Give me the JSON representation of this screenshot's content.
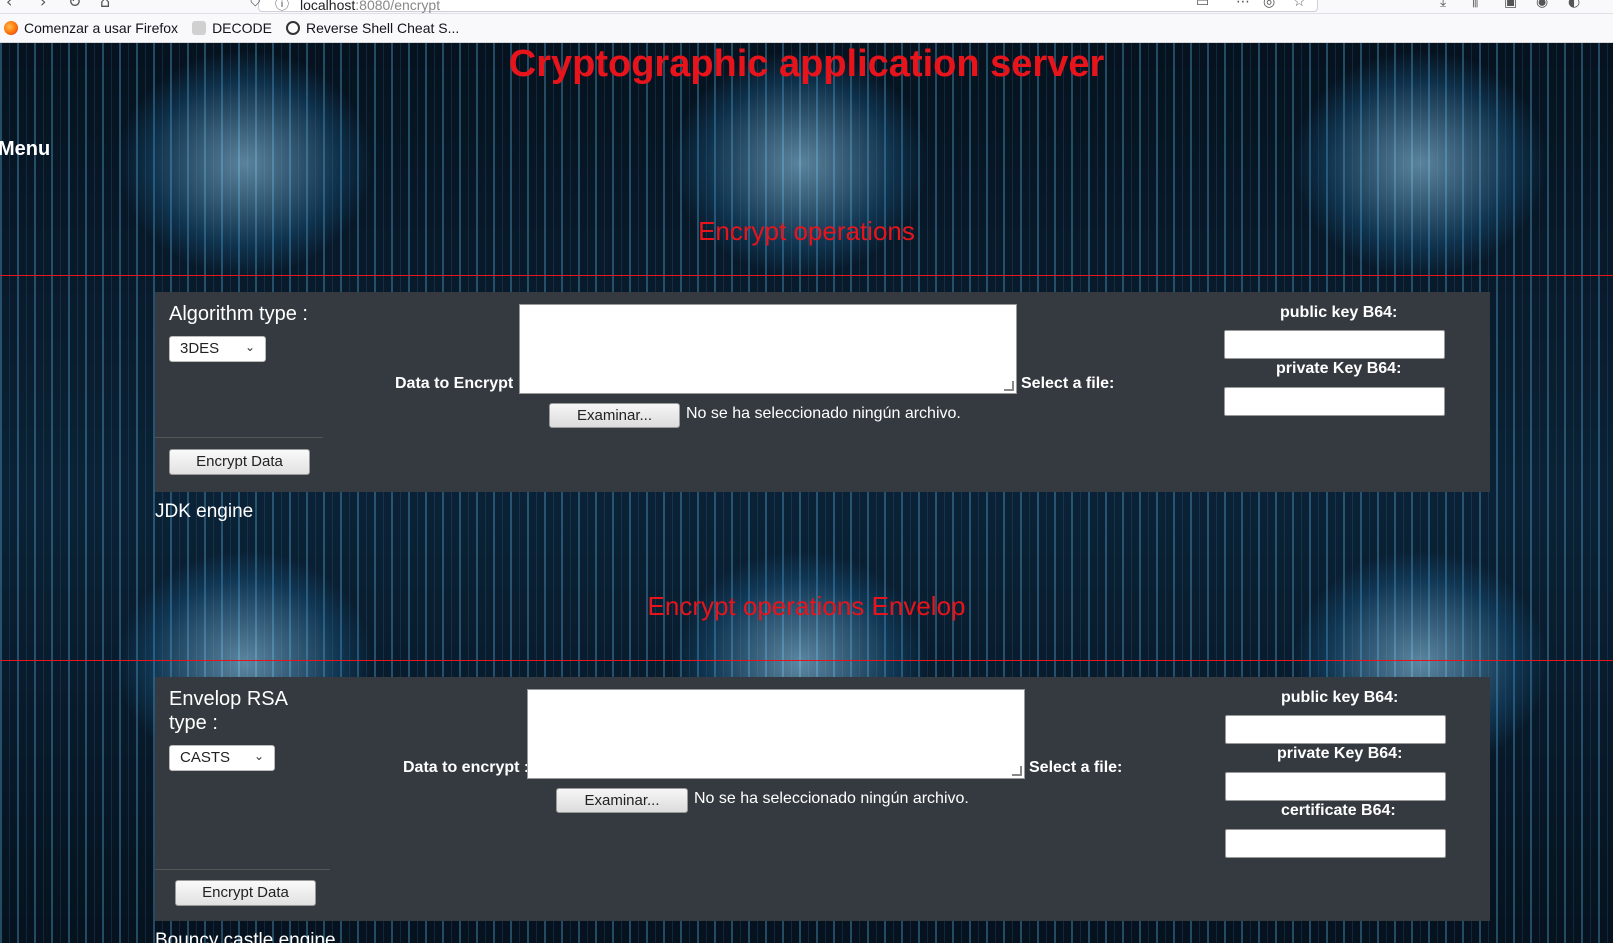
{
  "browser": {
    "url_host": "localhost",
    "url_rest": ":8080/encrypt",
    "bookmarks": [
      {
        "label": "Comenzar a usar Firefox"
      },
      {
        "label": "DECODE"
      },
      {
        "label": "Reverse Shell Cheat S..."
      }
    ]
  },
  "page": {
    "title": "Cryptographic application server",
    "menu_label": "Menu"
  },
  "encrypt": {
    "section_title": "Encrypt operations",
    "algorithm_label": "Algorithm type :",
    "algorithm_selected": "3DES",
    "data_label": "Data to Encrypt :",
    "file_label": "Select a file:",
    "browse_button": "Examinar...",
    "no_file_text": "No se ha seleccionado ningún archivo.",
    "public_key_label": "public key B64:",
    "private_key_label": "private Key B64:",
    "submit_button": "Encrypt Data",
    "engine_label": "JDK engine"
  },
  "envelop": {
    "section_title": "Encrypt operations Envelop",
    "type_label_line1": "Envelop RSA",
    "type_label_line2": "type :",
    "type_selected": "CASTS",
    "data_label": "Data to encrypt :",
    "file_label": "Select a file:",
    "browse_button": "Examinar...",
    "no_file_text": "No se ha seleccionado ningún archivo.",
    "public_key_label": "public key B64:",
    "private_key_label": "private Key B64:",
    "certificate_label": "certificate B64:",
    "submit_button": "Encrypt Data",
    "engine_label": "Bouncy castle engine"
  },
  "colors": {
    "title_red": "#e8141c",
    "panel_bg": "#343a40"
  }
}
